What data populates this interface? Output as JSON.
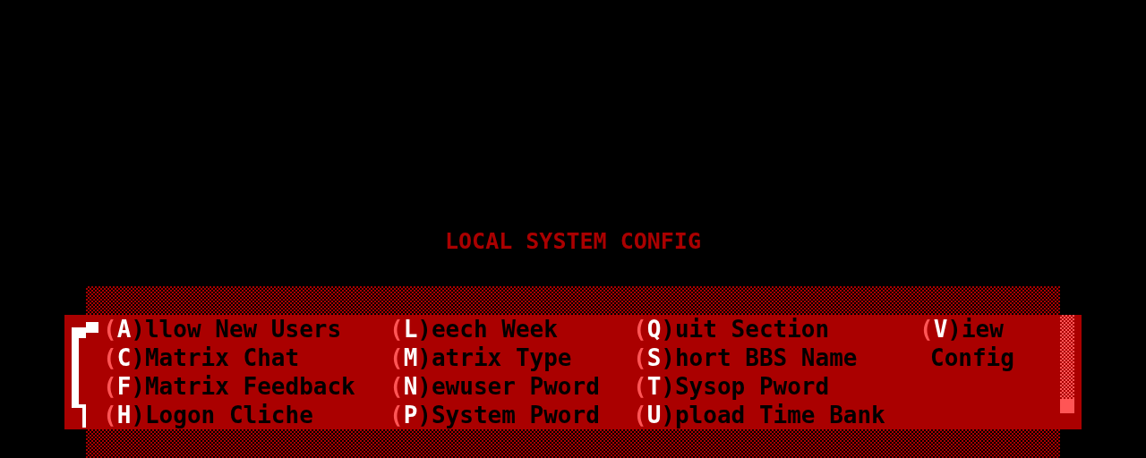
{
  "title": "LOCAL SYSTEM CONFIG",
  "menu": {
    "columns": [
      [
        {
          "kind": "option",
          "open": "(",
          "key": "A",
          "rest": ")llow New Users"
        },
        {
          "kind": "option",
          "open": "(",
          "key": "C",
          "rest": ")Matrix Chat"
        },
        {
          "kind": "option",
          "open": "(",
          "key": "F",
          "rest": ")Matrix Feedback"
        },
        {
          "kind": "option",
          "open": "(",
          "key": "H",
          "rest": ")Logon Cliche"
        }
      ],
      [
        {
          "kind": "option",
          "open": "(",
          "key": "L",
          "rest": ")eech Week"
        },
        {
          "kind": "option",
          "open": "(",
          "key": "M",
          "rest": ")atrix Type"
        },
        {
          "kind": "option",
          "open": "(",
          "key": "N",
          "rest": ")ewuser Pword"
        },
        {
          "kind": "option",
          "open": "(",
          "key": "P",
          "rest": ")System Pword"
        }
      ],
      [
        {
          "kind": "option",
          "open": "(",
          "key": "Q",
          "rest": ")uit Section"
        },
        {
          "kind": "option",
          "open": "(",
          "key": "S",
          "rest": ")hort BBS Name"
        },
        {
          "kind": "option",
          "open": "(",
          "key": "T",
          "rest": ")Sysop Pword"
        },
        {
          "kind": "option",
          "open": "(",
          "key": "U",
          "rest": ")pload Time Bank"
        }
      ],
      [
        {
          "kind": "option",
          "open": "(",
          "key": "V",
          "rest": ")iew"
        },
        {
          "kind": "continuation",
          "text": "Config"
        }
      ]
    ]
  }
}
